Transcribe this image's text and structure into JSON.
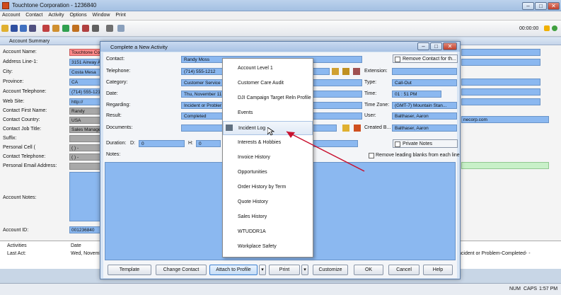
{
  "window": {
    "title": "Touchtone Corporation - 1236840"
  },
  "menu": [
    "Account",
    "Contact",
    "Activity",
    "Options",
    "Window",
    "Print"
  ],
  "toolbar": {
    "timer": "00:00:00"
  },
  "summary": {
    "title": "Account Summary",
    "labels": [
      "Account Name:",
      "Address Line-1:",
      "City:",
      "Province:",
      "Account Telephone:",
      "Web Site:",
      "Contact First Name:",
      "Contact Country:",
      "Contact Job Title:",
      "Suffix:",
      "Personal Cell (",
      "Contact Telephone:",
      "Personal Email Address:",
      "Account Notes:",
      "Account ID:"
    ],
    "values": [
      "Touchtone Co",
      "3151 Airway A",
      "Costa Mesa",
      "CA",
      "(714) 555-121",
      "http://",
      "Randy",
      "USA",
      "Sales Manage",
      "",
      "( ) -",
      "( ) -",
      "",
      "",
      "001236840"
    ],
    "right_link": "necorp.com",
    "bottom": {
      "col1": "Activities",
      "col2": "Date",
      "row_label": "Last Act:",
      "row_date": "Wed, November",
      "right_text": "ncident or Problem-Completed- -"
    }
  },
  "dialog": {
    "title": "Complete a New Activity",
    "contact_label": "Contact:",
    "contact": "Randy Moss",
    "telephone_label": "Telephone:",
    "telephone": "(714) 555-1212",
    "category_label": "Category:",
    "category": "Customer Service",
    "date_label": "Date:",
    "date": "Thu, November 11",
    "regarding_label": "Regarding:",
    "regarding": "Incident or Probler",
    "result_label": "Result:",
    "result": "Completed",
    "documents_label": "Documents:",
    "duration_label": "Duration:",
    "d_label": "D:",
    "d_value": "0",
    "h_label": "H:",
    "h_value": "0",
    "notes_label": "Notes:",
    "remove_contact": "Remove Contact for th...",
    "extension_label": "Extension:",
    "type_label": "Type:",
    "type": "Call-Out",
    "time_label": "Time:",
    "time": "01 : 51   PM",
    "timezone_label": "Time Zone:",
    "timezone": "(GMT-7) Mountain Stan...",
    "user_label": "User:",
    "user": "Balthaser, Aaron",
    "created_label": "Created B...",
    "created": "Balthaser, Aaron",
    "private_notes": "Private Notes",
    "remove_blanks": "Remove leading blanks from each line",
    "buttons": {
      "template": "Template",
      "change_contact": "Change Contact",
      "attach": "Attach to Profile",
      "print": "Print",
      "customize": "Customize",
      "ok": "OK",
      "cancel": "Cancel",
      "help": "Help"
    }
  },
  "popup": [
    "Account Level 1",
    "Customer Care Audit",
    "DJI Campaign Target Reln Profile",
    "Events",
    "Incident Log",
    "Interests & Hobbies",
    "Invoice History",
    "Opportunities",
    "Order History by Term",
    "Quote History",
    "Sales History",
    "WTUDDR1A",
    "Workplace Safety"
  ],
  "status": {
    "num": "NUM",
    "caps": "CAPS",
    "clock": "1:57 PM"
  },
  "colors": {
    "field": "#8bb8f0",
    "arrow": "#c8102e"
  }
}
